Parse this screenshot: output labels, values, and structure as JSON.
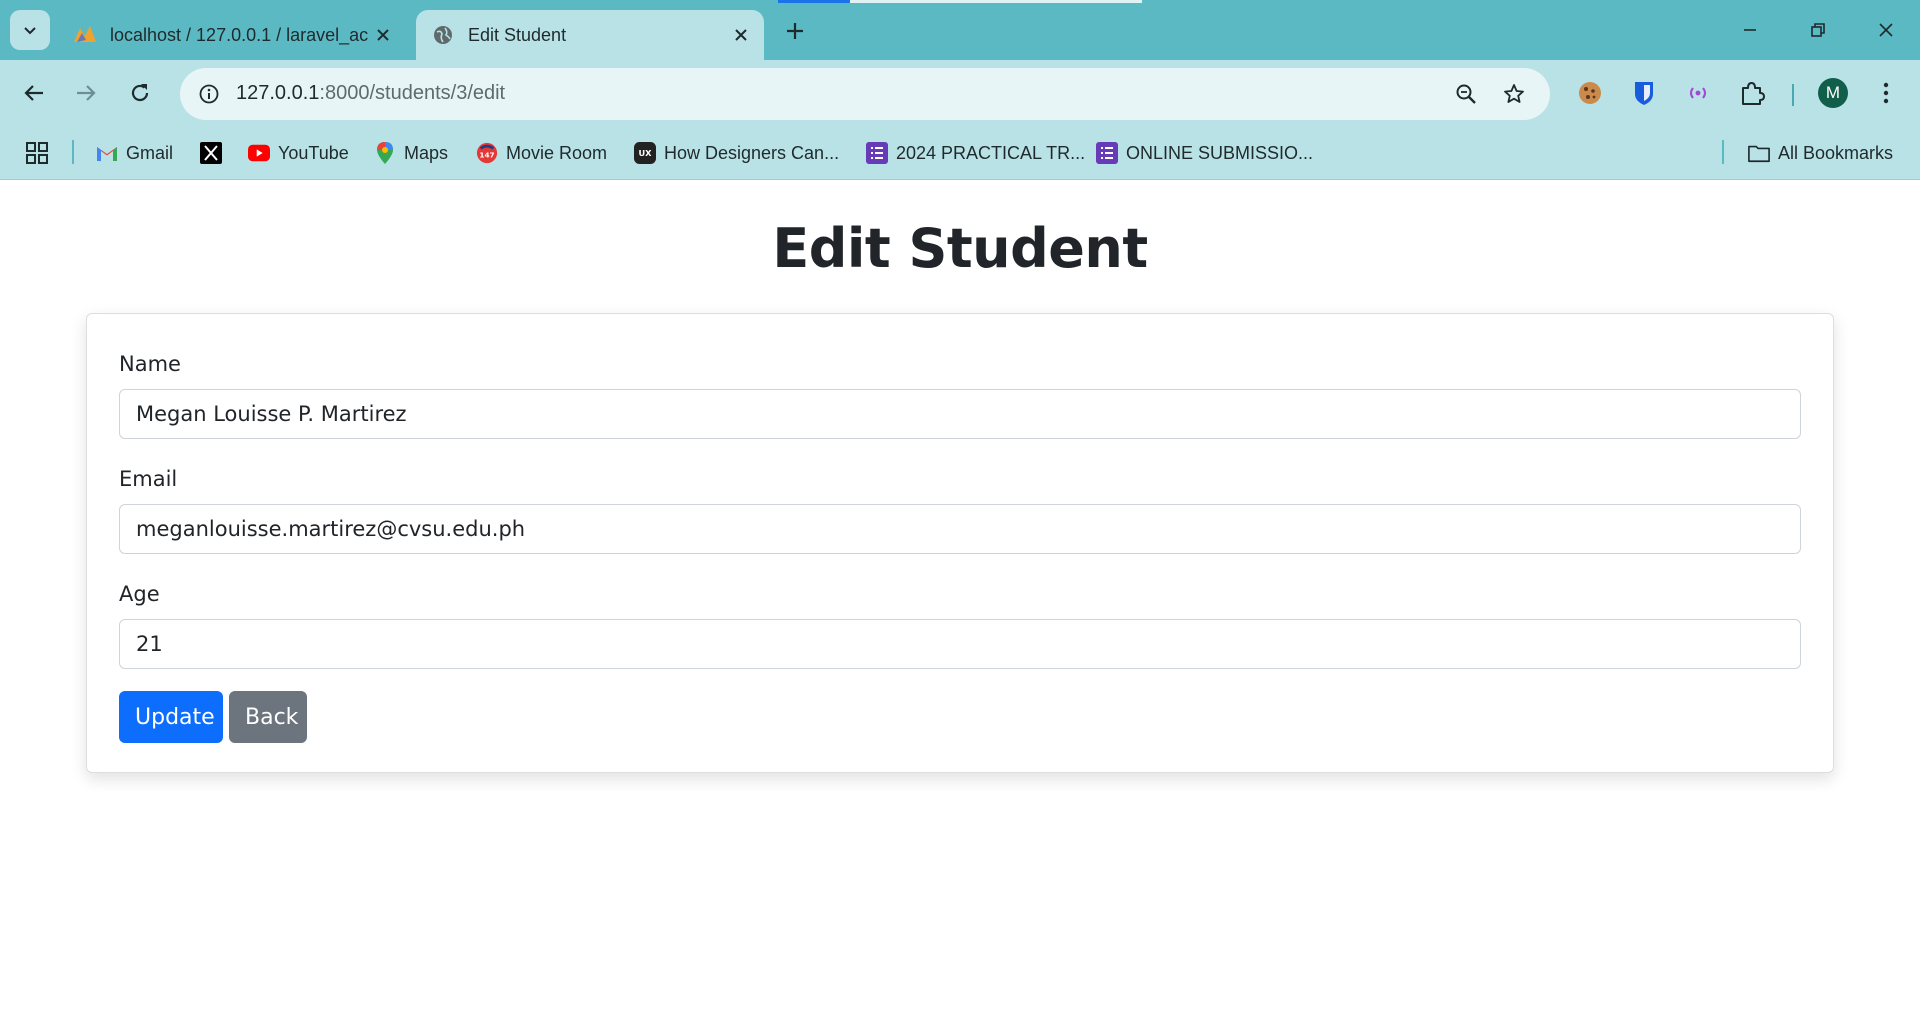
{
  "browser": {
    "tabs": [
      {
        "title": "localhost / 127.0.0.1 / laravel_ac",
        "favicon": "phpmyadmin-icon",
        "active": false
      },
      {
        "title": "Edit Student",
        "favicon": "globe-icon",
        "active": true
      }
    ],
    "address": {
      "host": "127.0.0.1",
      "path": ":8000/students/3/edit"
    },
    "profile_initial": "M",
    "bookmarks": [
      {
        "label": "Gmail",
        "icon": "gmail-icon"
      },
      {
        "label": "",
        "icon": "x-logo-icon"
      },
      {
        "label": "YouTube",
        "icon": "youtube-icon"
      },
      {
        "label": "Maps",
        "icon": "maps-icon"
      },
      {
        "label": "Movie Room",
        "icon": "movie-room-icon"
      },
      {
        "label": "How Designers Can...",
        "icon": "ux-icon"
      },
      {
        "label": "2024 PRACTICAL TR...",
        "icon": "forms-icon"
      },
      {
        "label": "ONLINE SUBMISSIO...",
        "icon": "forms-icon"
      }
    ],
    "all_bookmarks_label": "All Bookmarks"
  },
  "page": {
    "title": "Edit Student",
    "form": {
      "name_label": "Name",
      "name_value": "Megan Louisse P. Martirez",
      "email_label": "Email",
      "email_value": "meganlouisse.martirez@cvsu.edu.ph",
      "age_label": "Age",
      "age_value": "21",
      "update_label": "Update",
      "back_label": "Back"
    }
  },
  "colors": {
    "tabstrip": "#5bb9c4",
    "toolbar": "#b9e2e7",
    "primary_button": "#0d6efd",
    "secondary_button": "#6c757d"
  }
}
